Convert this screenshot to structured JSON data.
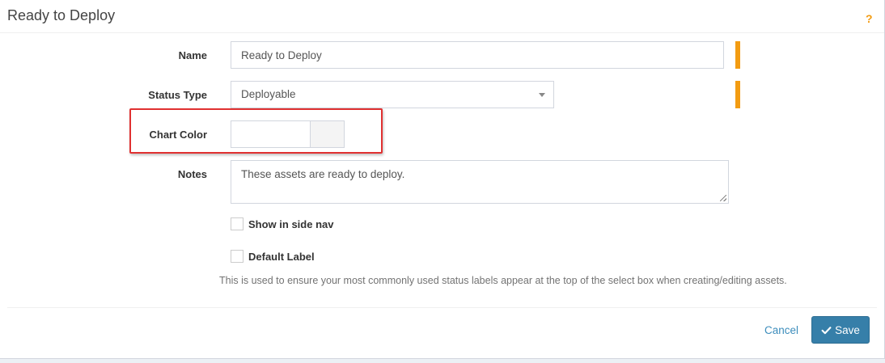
{
  "header": {
    "title": "Ready to Deploy",
    "help_icon": "question-icon",
    "help_symbol": "?"
  },
  "form": {
    "name": {
      "label": "Name",
      "value": "Ready to Deploy"
    },
    "status_type": {
      "label": "Status Type",
      "selected": "Deployable"
    },
    "chart_color": {
      "label": "Chart Color",
      "value": ""
    },
    "notes": {
      "label": "Notes",
      "value": "These assets are ready to deploy."
    },
    "show_in_side_nav": {
      "label": "Show in side nav",
      "checked": false
    },
    "default_label": {
      "label": "Default Label",
      "checked": false
    },
    "help_text": "This is used to ensure your most commonly used status labels appear at the top of the select box when creating/editing assets."
  },
  "footer": {
    "cancel_label": "Cancel",
    "save_label": "Save",
    "save_icon": "check-icon"
  },
  "colors": {
    "required": "#f39c12",
    "highlight": "#e03131",
    "primary_button": "#367fa9",
    "link": "#3c8dbc"
  }
}
